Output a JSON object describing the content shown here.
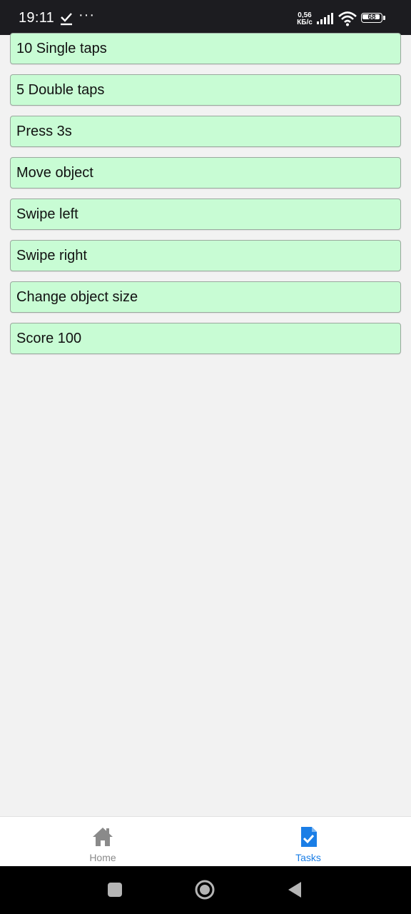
{
  "status_bar": {
    "time": "19:11",
    "dots": "···",
    "speed_value": "0,56",
    "speed_unit": "КБ/с",
    "battery": "68"
  },
  "tasks": [
    "10 Single taps",
    "5 Double taps",
    "Press 3s",
    "Move object",
    "Swipe left",
    "Swipe right",
    "Change object size",
    "Score 100"
  ],
  "bottom_nav": {
    "home_label": "Home",
    "tasks_label": "Tasks",
    "active": "tasks",
    "active_color": "#1a7ee6",
    "inactive_color": "#8a8a8a"
  },
  "icons": {
    "home": "home-icon",
    "tasks": "task-check-icon",
    "recent": "recent-apps-icon",
    "system_home": "system-home-icon",
    "back": "back-icon"
  },
  "colors": {
    "task_background": "#c8fcd4",
    "page_background": "#f2f2f2",
    "status_bar": "#1c1c20"
  }
}
